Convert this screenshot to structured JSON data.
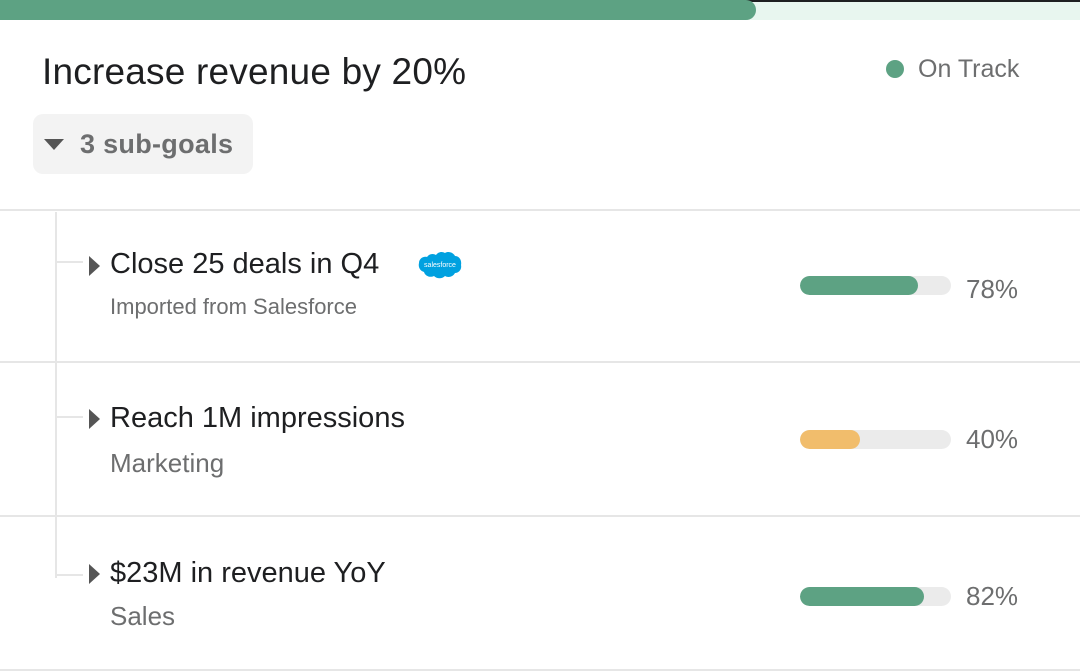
{
  "top_progress": {
    "value_percent": 70,
    "color": "#5da283"
  },
  "goal": {
    "title": "Increase revenue by 20%",
    "status": {
      "label": "On Track",
      "color": "#5da283"
    },
    "subgoals_toggle_label": "3 sub-goals"
  },
  "subgoals": [
    {
      "title": "Close 25 deals in Q4",
      "subtitle": "Imported from Salesforce",
      "integration_icon": "salesforce-icon",
      "integration_label": "salesforce",
      "progress": 78,
      "progress_label": "78%",
      "bar_color": "#5da283"
    },
    {
      "title": "Reach 1M impressions",
      "subtitle": "Marketing",
      "progress": 40,
      "progress_label": "40%",
      "bar_color": "#f1bd6c"
    },
    {
      "title": "$23M in revenue YoY",
      "subtitle": "Sales",
      "progress": 82,
      "progress_label": "82%",
      "bar_color": "#5da283"
    }
  ]
}
